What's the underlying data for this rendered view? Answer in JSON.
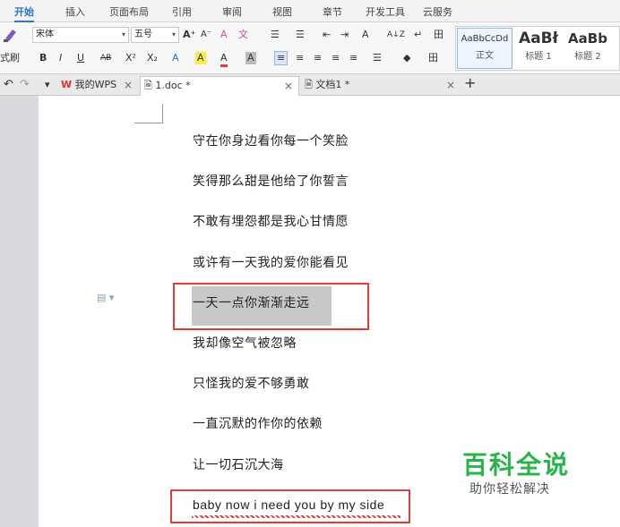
{
  "menu": {
    "items": [
      "开始",
      "插入",
      "页面布局",
      "引用",
      "审阅",
      "视图",
      "章节",
      "开发工具",
      "云服务"
    ]
  },
  "ribbon": {
    "format_painter_label": "式刷",
    "font_name": "宋体",
    "font_size": "五号",
    "grow_font": "A⁺",
    "shrink_font": "A⁻",
    "clear_format": "A",
    "phonetic": "文",
    "bold": "B",
    "italic": "I",
    "underline": "U",
    "strike": "AB",
    "superscript": "X²",
    "subscript": "X₂",
    "text_effect": "A",
    "highlight": "A",
    "font_color": "A",
    "char_shade": "A",
    "list_bullets": "☰",
    "list_numbers": "☰",
    "indent_dec": "⇤",
    "indent_inc": "⇥",
    "case": "A",
    "sort": "A↓Z",
    "show_marks": "↵",
    "table_border": "田",
    "align_left": "≡",
    "align_center": "≡",
    "align_right": "≡",
    "justify": "≡",
    "distribute": "≡",
    "line_spacing": "☰",
    "shading": "◆",
    "borders": "田",
    "styles": [
      {
        "sample": "AaBbCcDd",
        "name": "正文"
      },
      {
        "sample": "AaBł",
        "name": "标题 1"
      },
      {
        "sample": "AaBb",
        "name": "标题 2"
      }
    ]
  },
  "tabs": {
    "undo": "↶",
    "redo": "↷",
    "dropdown": "▾",
    "items": [
      {
        "label": "我的WPS",
        "close": "×"
      },
      {
        "label": "1.doc *",
        "close": "×"
      },
      {
        "label": "文档1 *",
        "close": "×"
      }
    ],
    "add": "+"
  },
  "document": {
    "lines": [
      "守在你身边看你每一个笑脸",
      "笑得那么甜是他给了你誓言",
      "不敢有埋怨都是我心甘情愿",
      "或许有一天我的爱你能看见",
      "一天一点你渐渐走远",
      "我却像空气被忽略",
      "只怪我的爱不够勇敢",
      "一直沉默的作你的依赖",
      "让一切石沉大海",
      "baby now i need you by my side"
    ],
    "margin_icon": "▤ ▾"
  },
  "watermark": {
    "title": "百科全说",
    "subtitle": "助你轻松解决"
  },
  "colors": {
    "accent": "#2f75c8",
    "highlight_box": "#e23b3b",
    "selection": "#c8c8c8",
    "watermark": "#29b34b"
  }
}
